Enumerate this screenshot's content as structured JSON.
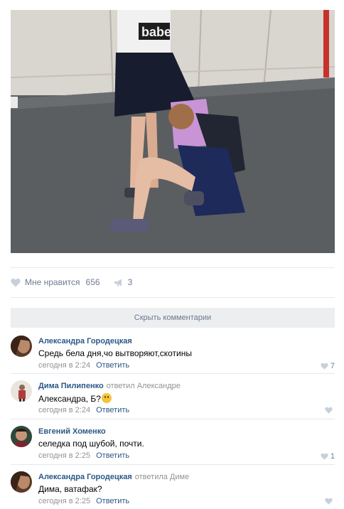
{
  "post": {
    "photo_text": "babe",
    "likes_label": "Мне нравится",
    "likes_count": "656",
    "shares_count": "3"
  },
  "hide_comments_label": "Скрыть комментарии",
  "comments": [
    {
      "author": "Александра Городецкая",
      "reply_to": "",
      "text": "Средь бела дня,чо вытворяют,скотины",
      "time": "сегодня в 2:24",
      "reply_label": "Ответить",
      "likes": "7"
    },
    {
      "author": "Дима Пилипенко",
      "reply_to": "ответил Александре",
      "text": "Александра, Б?",
      "time": "сегодня в 2:24",
      "reply_label": "Ответить",
      "likes": ""
    },
    {
      "author": "Евгений Хоменко",
      "reply_to": "",
      "text": "селедка под шубой, почти.",
      "time": "сегодня в 2:25",
      "reply_label": "Ответить",
      "likes": "1"
    },
    {
      "author": "Александра Городецкая",
      "reply_to": "ответила Диме",
      "text": "Дима, ватафак?",
      "time": "сегодня в 2:25",
      "reply_label": "Ответить",
      "likes": ""
    }
  ],
  "colors": {
    "link": "#2a5885",
    "muted": "#939393",
    "action": "#6e7d90",
    "bar_bg": "#edeef0"
  }
}
